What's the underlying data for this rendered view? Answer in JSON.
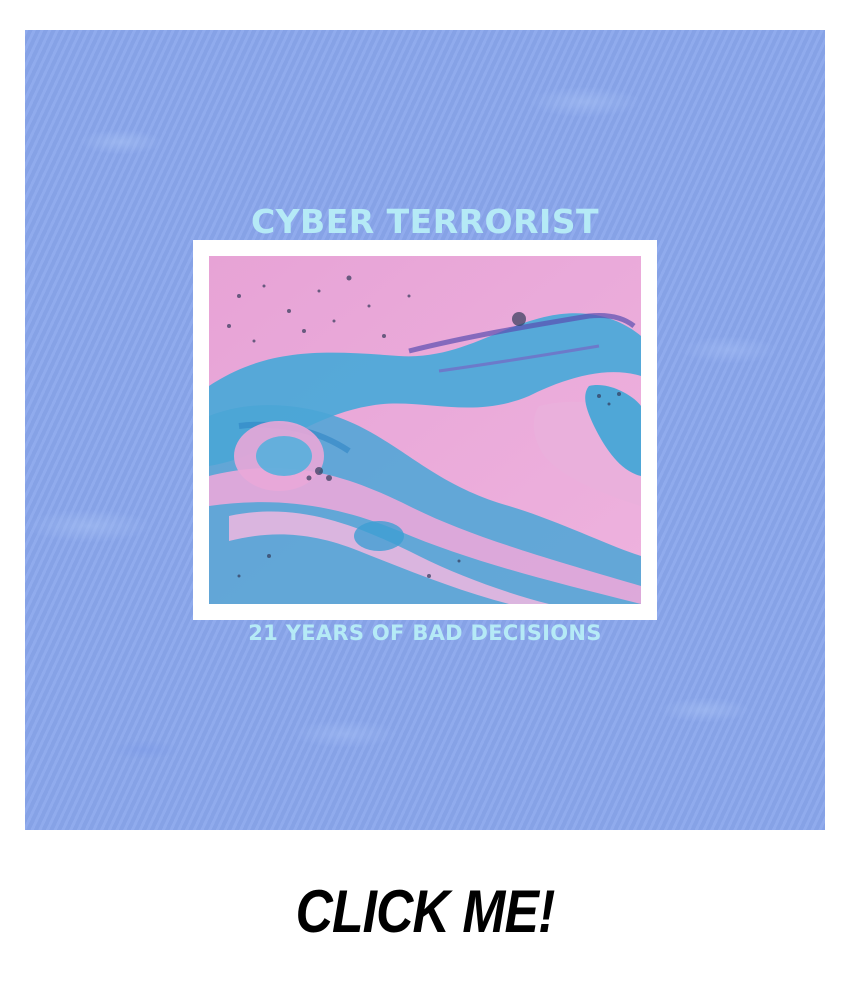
{
  "album": {
    "title": "CYBER TERRORIST",
    "subtitle": "21 YEARS OF BAD DECISIONS",
    "artwork": "pink-and-blue-marbled-paint"
  },
  "cta": {
    "label": "CLICK ME!"
  },
  "colors": {
    "background": "#8aa7ec",
    "text_accent": "#b5eaf6",
    "frame": "#ffffff",
    "art_pink": "#e9a8d9",
    "art_blue": "#3fa5d6"
  }
}
